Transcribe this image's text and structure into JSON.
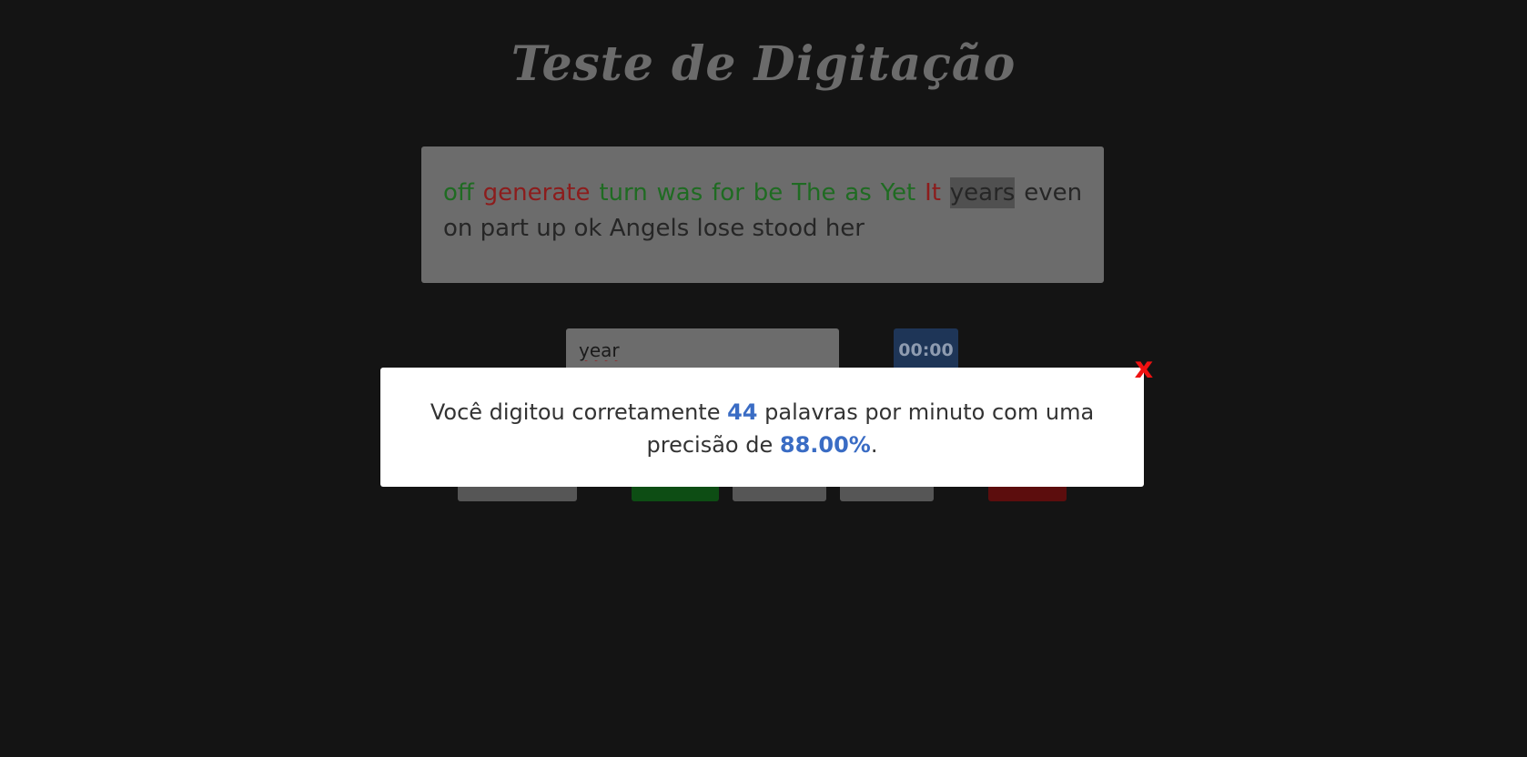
{
  "title": "Teste de Digitação",
  "words": [
    {
      "text": "off",
      "status": "correct"
    },
    {
      "text": "generate",
      "status": "wrong"
    },
    {
      "text": "turn",
      "status": "correct"
    },
    {
      "text": "was",
      "status": "correct"
    },
    {
      "text": "for",
      "status": "correct"
    },
    {
      "text": "be",
      "status": "correct"
    },
    {
      "text": "The",
      "status": "correct"
    },
    {
      "text": "as",
      "status": "correct"
    },
    {
      "text": "Yet",
      "status": "correct"
    },
    {
      "text": "It",
      "status": "wrong"
    },
    {
      "text": "years",
      "status": "current"
    },
    {
      "text": "even",
      "status": "pending"
    },
    {
      "text": "on",
      "status": "pending"
    },
    {
      "text": "part",
      "status": "pending"
    },
    {
      "text": "up",
      "status": "pending"
    },
    {
      "text": "ok",
      "status": "pending"
    },
    {
      "text": "Angels",
      "status": "pending"
    },
    {
      "text": "lose",
      "status": "pending"
    },
    {
      "text": "stood",
      "status": "pending"
    },
    {
      "text": "her",
      "status": "pending"
    }
  ],
  "input": {
    "value": "year"
  },
  "timer": "00:00",
  "colors": {
    "correct": "#1f6b22",
    "wrong": "#8c1c1c",
    "highlight": "#3a6cc4",
    "close": "#ee1111"
  },
  "result": {
    "text_before": "Você digitou corretamente ",
    "wpm": "44",
    "text_middle": " palavras por minuto com uma precisão de ",
    "accuracy": "88.00%",
    "text_after": ".",
    "close_label": "x"
  }
}
